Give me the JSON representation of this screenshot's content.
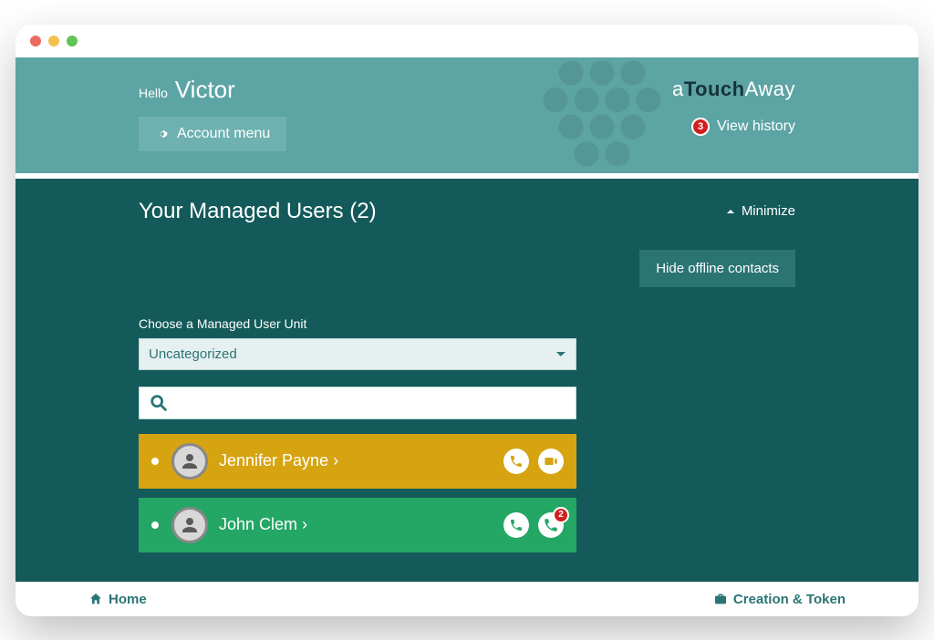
{
  "header": {
    "greeting_prefix": "Hello",
    "user_name": "Victor",
    "account_menu_label": "Account menu",
    "brand_a": "a",
    "brand_touch": "Touch",
    "brand_away": "Away",
    "view_history_label": "View history",
    "history_badge": "3"
  },
  "main": {
    "section_title": "Your  Managed Users (2)",
    "minimize_label": "Minimize",
    "hide_offline_label": "Hide offline contacts",
    "unit_label": "Choose a Managed User Unit",
    "unit_selected": "Uncategorized",
    "search_placeholder": ""
  },
  "users": [
    {
      "name": "Jennifer Payne ›",
      "row_color": "yellow",
      "badge": null
    },
    {
      "name": "John Clem ›",
      "row_color": "green",
      "badge": "2"
    }
  ],
  "footer": {
    "home_label": "Home",
    "creation_label": "Creation & Token"
  },
  "colors": {
    "header_bg": "#5da4a4",
    "main_bg": "#145a5a",
    "accent_yellow": "#d6a411",
    "accent_green": "#24a665",
    "badge_red": "#d01f1f"
  }
}
